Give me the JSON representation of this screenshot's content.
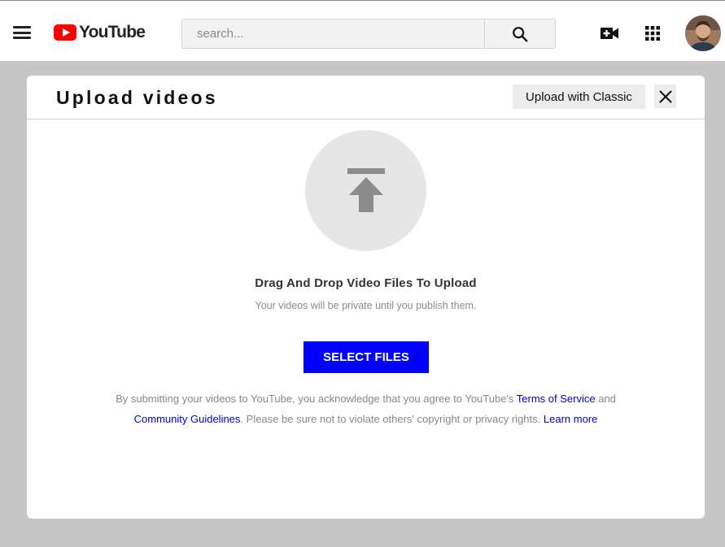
{
  "header": {
    "logo_text": "YouTube",
    "search_placeholder": "search...",
    "brand_color": "#ff0000"
  },
  "icons": {
    "menu": "hamburger-menu-icon",
    "search": "search-icon",
    "create": "video-camera-add-icon",
    "apps": "apps-grid-icon",
    "avatar": "user-avatar",
    "upload": "upload-arrow-icon",
    "close": "close-icon"
  },
  "modal": {
    "title": "Upload videos",
    "classic_button": "Upload with Classic",
    "drag_title": "Drag And Drop Video Files To Upload",
    "drag_subtitle": "Your videos will be private until you publish them.",
    "select_button": "SELECT FILES",
    "legal": {
      "part1": "By submitting your videos to YouTube, you acknowledge that you agree to YouTube's ",
      "tos_link": "Terms of Service",
      "part2": " and ",
      "guidelines_link": "Community Guidelines",
      "part3": ". Please be sure not to violate others' copyright or privacy rights. ",
      "learn_more_link": "Learn more"
    }
  },
  "colors": {
    "primary_button": "#0000ff",
    "link": "#0000dd",
    "overlay": "#c6c6c6"
  }
}
